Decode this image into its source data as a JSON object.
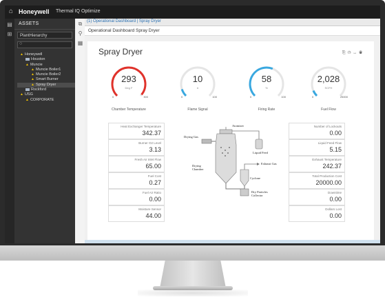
{
  "app": {
    "brand": "Honeywell",
    "product": "Thermal IQ Optimize"
  },
  "sidebar": {
    "title": "ASSETS",
    "hierarchy_dropdown": "PlantHierarchy",
    "tree": [
      {
        "label": "Honeywell",
        "level": 0,
        "icon": "warning-icon"
      },
      {
        "label": "Houston",
        "level": 1,
        "icon": "building-icon"
      },
      {
        "label": "Muncie",
        "level": 1,
        "icon": "warning-icon"
      },
      {
        "label": "Muncie Boiler1",
        "level": 2,
        "icon": "warning-icon"
      },
      {
        "label": "Muncie Boiler2",
        "level": 2,
        "icon": "warning-icon"
      },
      {
        "label": "Smart Burner",
        "level": 2,
        "icon": "warning-icon"
      },
      {
        "label": "Spray Dryer",
        "level": 2,
        "icon": "warning-icon",
        "selected": true
      },
      {
        "label": "Rockford",
        "level": 1,
        "icon": "building-icon"
      },
      {
        "label": "USG",
        "level": 0,
        "icon": "warning-icon"
      },
      {
        "label": "CORPORATE",
        "level": 1,
        "icon": "warning-icon"
      }
    ]
  },
  "tabs": [
    {
      "label": "(1) Operational Dashboard | Spray Dryer"
    }
  ],
  "subheader": {
    "title": "Operational Dashboard Spray Dryer"
  },
  "panel": {
    "title": "Spray Dryer"
  },
  "gauges": [
    {
      "value": "293",
      "unit": "Deg F",
      "min": "0",
      "max": "300",
      "label": "Chamber Temperature",
      "fraction": 0.98,
      "color": "#e0322b"
    },
    {
      "value": "10",
      "unit": "#",
      "min": "0",
      "max": "100",
      "label": "Flame Signal",
      "fraction": 0.1,
      "color": "#39a8e0"
    },
    {
      "value": "58",
      "unit": "%",
      "min": "0",
      "max": "100",
      "label": "Firing Rate",
      "fraction": 0.58,
      "color": "#39a8e0"
    },
    {
      "value": "2,028",
      "unit": "SCFH",
      "min": "0",
      "max": "25000",
      "label": "Fuel Flow",
      "fraction": 0.08,
      "color": "#39a8e0"
    }
  ],
  "kpis_left": [
    {
      "label": "Heat Exchanger Temperature",
      "value": "342.37"
    },
    {
      "label": "Burner O2 Level",
      "value": "3.13"
    },
    {
      "label": "Fresh Air Inlet Flow",
      "value": "65.00"
    },
    {
      "label": "Fuel Cost",
      "value": "0.27"
    },
    {
      "label": "Fuel Air Ratio",
      "value": "0.00"
    },
    {
      "label": "Moisture Sensor",
      "value": "44.00"
    }
  ],
  "kpis_right": [
    {
      "label": "Number of Lockouts",
      "value": "0.00"
    },
    {
      "label": "Liquid Feed Flow",
      "value": "5.15"
    },
    {
      "label": "Exhaust Temperature",
      "value": "242.37"
    },
    {
      "label": "Total Production Cost",
      "value": "20000.00"
    },
    {
      "label": "Downtime",
      "value": "0.00"
    },
    {
      "label": "Dollars Lost",
      "value": "0.00"
    }
  ],
  "diagram": {
    "atomizer": "Atomizer",
    "drying_gas": "Drying Gas",
    "liquid_feed": "Liquid Feed",
    "drying_chamber": "Drying Chamber",
    "exhaust_gas": "Exhaust Gas",
    "cyclone": "Cyclone",
    "dry_particles": "Dry Particles Collector"
  }
}
